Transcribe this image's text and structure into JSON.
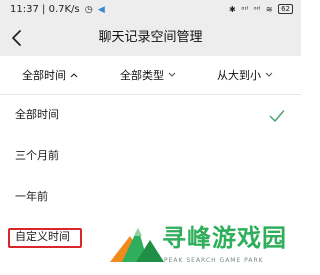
{
  "status_bar": {
    "time": "11:37",
    "speed": "0.7K/s",
    "bluetooth": "✱",
    "signal_1": "ᵒᶦˡ",
    "signal_2": "ᵒᶦˡ",
    "wifi": "≋",
    "battery": "62"
  },
  "header": {
    "back": "‹",
    "title": "聊天记录空间管理"
  },
  "filters": {
    "time": "全部时间",
    "time_chevron": "^",
    "type": "全部类型",
    "type_chevron": "⌄",
    "sort": "从大到小",
    "sort_chevron": "⌄"
  },
  "options": {
    "all": "全部时间",
    "three_months": "三个月前",
    "one_year": "一年前",
    "custom": "自定义时间"
  },
  "watermark": {
    "title": "寻峰游戏园",
    "subtitle": "PEAK SEARCH GAME PARK"
  },
  "colors": {
    "check": "#3fa06a",
    "highlight": "#d9262c",
    "watermark": "#2fae5b"
  }
}
